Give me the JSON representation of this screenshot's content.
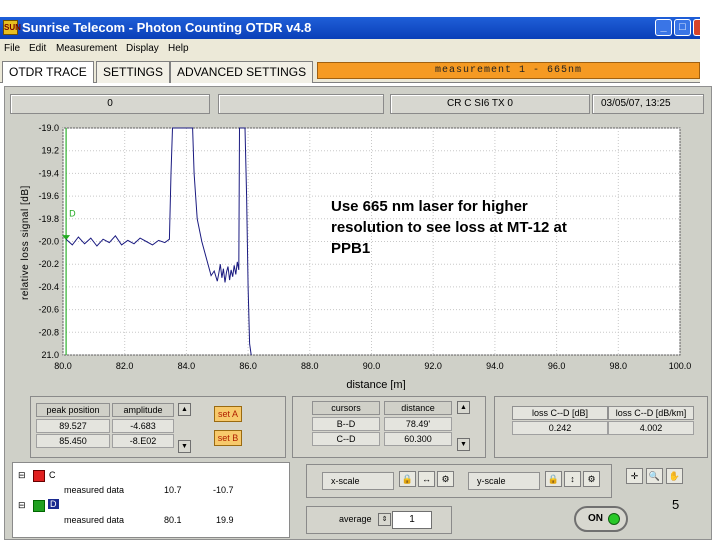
{
  "window": {
    "title": "Sunrise Telecom - Photon Counting OTDR v4.8",
    "icon_text": "SUN",
    "controls": [
      "minimize-icon",
      "maximize-icon",
      "close-icon"
    ]
  },
  "menu": [
    "File",
    "Edit",
    "Measurement",
    "Display",
    "Help"
  ],
  "tabs": [
    "OTDR TRACE",
    "SETTINGS",
    "ADVANCED SETTINGS"
  ],
  "measurement_banner": "measurement  1  -  665nm",
  "status": {
    "left": "0",
    "mid": "",
    "channel": "CR C SI6 TX 0",
    "datetime": "03/05/07, 13:25"
  },
  "plot": {
    "ylabel": "relative loss signal [dB]",
    "xlabel": "distance [m]",
    "marker_c": "C",
    "marker_d": "D"
  },
  "chart_data": {
    "type": "line",
    "xlabel": "distance [m]",
    "ylabel": "relative loss signal [dB]",
    "xlim": [
      80.0,
      100.0
    ],
    "ylim": [
      -21.0,
      -19.0
    ],
    "y_reversed": true,
    "xticks": [
      "80.0",
      "82.0",
      "84.0",
      "86.0",
      "88.0",
      "90.0",
      "92.0",
      "94.0",
      "96.0",
      "98.0",
      "100.0"
    ],
    "yticks": [
      "-19.0",
      "19.2",
      "-19.4",
      "-19.6",
      "-19.8",
      "-20.0",
      "-20.2",
      "-20.4",
      "-20.6",
      "-20.8",
      "21.0"
    ],
    "grid": true,
    "series": [
      {
        "color": "#1a1a80",
        "x": [
          80.1,
          80.3,
          80.5,
          80.7,
          80.9,
          81.1,
          81.3,
          81.5,
          81.7,
          81.9,
          82.1,
          82.3,
          82.5,
          82.7,
          82.9,
          83.1,
          83.3,
          83.45,
          83.5,
          83.55,
          83.6,
          83.65,
          84.2,
          84.25,
          84.35,
          84.5,
          84.6,
          84.7,
          84.8,
          84.9,
          85.0,
          85.05,
          85.1,
          85.15,
          85.2,
          85.25,
          85.3,
          85.35,
          85.4,
          85.45,
          85.5,
          85.55,
          85.6,
          85.65,
          85.7,
          85.72,
          85.9,
          85.95,
          86.0,
          86.05,
          86.1
        ],
        "y": [
          -19.98,
          -20.03,
          -19.96,
          -20.02,
          -19.97,
          -20.04,
          -19.98,
          -20.01,
          -19.95,
          -20.03,
          -19.99,
          -20.02,
          -19.97,
          -20.0,
          -20.03,
          -19.99,
          -20.01,
          -19.98,
          -19.4,
          -19.0,
          -19.0,
          -19.0,
          -19.0,
          -19.4,
          -19.8,
          -20.0,
          -20.1,
          -20.2,
          -20.3,
          -20.26,
          -20.35,
          -20.28,
          -20.2,
          -20.32,
          -20.24,
          -20.36,
          -20.27,
          -20.22,
          -20.34,
          -20.25,
          -20.31,
          -20.21,
          -20.29,
          -20.18,
          -20.25,
          -19.0,
          -19.0,
          -19.6,
          -20.4,
          -20.9,
          -21.0
        ]
      }
    ],
    "markers": [
      {
        "name": "C",
        "x": 80.1,
        "color": "#22aa22"
      },
      {
        "name": "D",
        "x": 80.1,
        "color": "#22aa22"
      }
    ]
  },
  "annotation": "Use 665 nm laser for higher resolution to see loss at MT-12 at PPB1",
  "peak_table": {
    "headers": [
      "peak position",
      "amplitude"
    ],
    "rows": [
      [
        "89.527",
        "-4.683"
      ],
      [
        "85.450",
        "-8.E02"
      ]
    ],
    "set_a": "set A",
    "set_b": "set B"
  },
  "cursor_table": {
    "headers": [
      "cursors",
      "distance"
    ],
    "rows": [
      [
        "B--D",
        "78.49'"
      ],
      [
        "C--D",
        "60.300"
      ]
    ]
  },
  "loss_table": {
    "headers": [
      "loss C--D [dB]",
      "loss C--D [dB/km]"
    ],
    "values": [
      "0.242",
      "4.002"
    ]
  },
  "tree": {
    "items": [
      {
        "label": "C",
        "name": "measured data",
        "v1": "10.7",
        "v2": "-10.7",
        "color": "#e02020"
      },
      {
        "label": "D",
        "name": "measured data",
        "v1": "80.1",
        "v2": "19.9",
        "color": "#20a020"
      }
    ]
  },
  "scale": {
    "x_label": "x-scale",
    "y_label": "y-scale",
    "average_label": "average",
    "average_value": "1",
    "on_label": "ON"
  },
  "page_number": "5"
}
